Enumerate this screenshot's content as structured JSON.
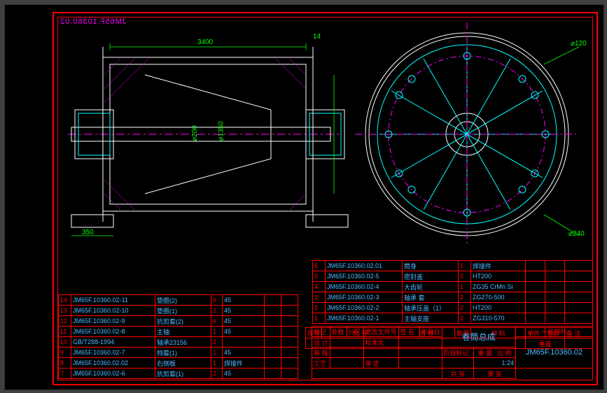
{
  "drawing_number": "JM65F.10360.02",
  "drawing_number_mirror": "JM65F.10360.02",
  "assembly_name": "卷筒总成",
  "classification": "一级部件",
  "dims": {
    "len_3400": "3400",
    "dia_200": "⌀200",
    "dia_120": "⌀120",
    "dia_240": "⌀240",
    "w_350": "350",
    "dia_1350": "⌀1350",
    "n_14": "14"
  },
  "bom_upper": [
    {
      "no": "6",
      "code": "JM65F.10360.02.01",
      "name": "筒身",
      "qty": "1",
      "mat": "焊接件"
    },
    {
      "no": "5",
      "code": "JM65F.10360.02-5",
      "name": "密封盖",
      "qty": "2",
      "mat": "HT200"
    },
    {
      "no": "4",
      "code": "JM65F.10360.02-4",
      "name": "大齿轮",
      "qty": "1",
      "mat": "ZG35 CrMn Si"
    },
    {
      "no": "3",
      "code": "JM65F.10360.02-3",
      "name": "轴承 套",
      "qty": "2",
      "mat": "ZG270-500"
    },
    {
      "no": "2",
      "code": "JM65F.10360.02-2",
      "name": "轴承压盖（1）",
      "qty": "2",
      "mat": "HT200"
    },
    {
      "no": "1",
      "code": "JM65F.10360.02-1",
      "name": "主轴支座",
      "qty": "2",
      "mat": "ZG310-570"
    }
  ],
  "bom_header": {
    "no": "序号",
    "code": "代    号",
    "name": "名    称",
    "qty": "数量",
    "mat": "材    料",
    "wt1": "单件",
    "wt2": "总计",
    "rem": "备 注",
    "wt": "重量"
  },
  "bom_left": [
    {
      "no": "14",
      "code": "JM65F.10360.02-11",
      "name": "垫圈(2)",
      "qty": "6",
      "mat": "45"
    },
    {
      "no": "13",
      "code": "JM65F.10360.02-10",
      "name": "垫圈(1)",
      "qty": "2",
      "mat": "45"
    },
    {
      "no": "12",
      "code": "JM65F.10360.02-9",
      "name": "抗剪套(2)",
      "qty": "6",
      "mat": "45"
    },
    {
      "no": "11",
      "code": "JM65F.10360.02-8",
      "name": "主轴",
      "qty": "1",
      "mat": "45"
    },
    {
      "no": "10",
      "code": "GB/T288-1994",
      "name": "轴承23156",
      "qty": "2",
      "mat": ""
    },
    {
      "no": "9",
      "code": "JM65F.10360.02-7",
      "name": "档套(1)",
      "qty": "1",
      "mat": "45"
    },
    {
      "no": "8",
      "code": "JM65F.10360.02.02",
      "name": "右侧板",
      "qty": "1",
      "mat": "焊接件"
    },
    {
      "no": "7",
      "code": "JM65F.10360.02-6",
      "name": "抗剪套(1)",
      "qty": "2",
      "mat": "45"
    }
  ],
  "title_cells": {
    "mark": "标记",
    "zone": "处数",
    "rev": "分区",
    "change": "更改文件号",
    "sig": "签 名",
    "date": "年月日",
    "design": "设 计",
    "std": "标准化",
    "stage": "阶段标记",
    "mass": "重 量",
    "scale": "比 例",
    "check": "审 核",
    "scale_v": "1:24",
    "proc": "工艺",
    "appr": "审 定",
    "sheet": "共  张",
    "page": "第  张"
  }
}
